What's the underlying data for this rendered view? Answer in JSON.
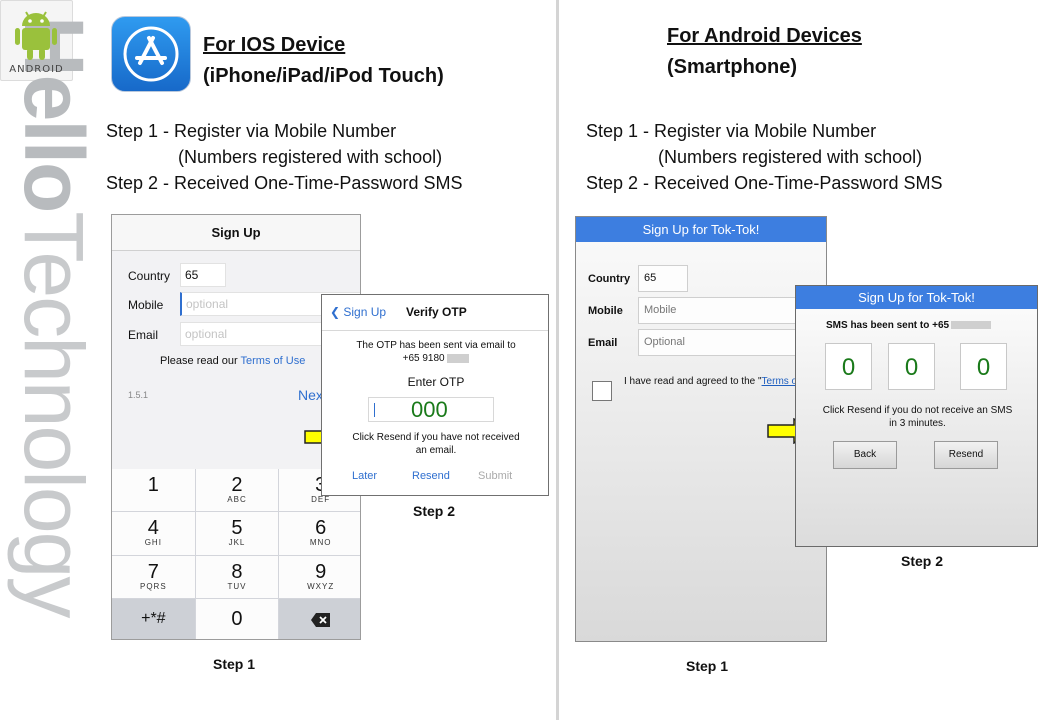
{
  "brand": {
    "bold": "Hello",
    "rest": "Technology"
  },
  "ios": {
    "header_line1": "For IOS Device",
    "header_line2": "(iPhone/iPad/iPod Touch)",
    "icon": "app-store-icon",
    "steps": {
      "step1": "Step 1 - Register via Mobile Number",
      "step1_note": "(Numbers registered with school)",
      "step2": "Step 2 - Received One-Time-Password SMS"
    },
    "signup": {
      "title": "Sign Up",
      "country_label": "Country",
      "country_value": "65",
      "mobile_label": "Mobile",
      "mobile_placeholder": "optional",
      "email_label": "Email",
      "email_placeholder": "optional",
      "terms_prefix": "Please read our",
      "terms_link": "Terms of Use",
      "version": "1.5.1",
      "next": "Next"
    },
    "keypad": [
      {
        "n": "1",
        "l": ""
      },
      {
        "n": "2",
        "l": "ABC"
      },
      {
        "n": "3",
        "l": "DEF"
      },
      {
        "n": "4",
        "l": "GHI"
      },
      {
        "n": "5",
        "l": "JKL"
      },
      {
        "n": "6",
        "l": "MNO"
      },
      {
        "n": "7",
        "l": "PQRS"
      },
      {
        "n": "8",
        "l": "TUV"
      },
      {
        "n": "9",
        "l": "WXYZ"
      },
      {
        "n": "+*#",
        "l": ""
      },
      {
        "n": "0",
        "l": ""
      },
      {
        "n": "",
        "l": ""
      }
    ],
    "otp": {
      "back": "Sign Up",
      "title": "Verify OTP",
      "msg_line1": "The OTP has been sent via email to",
      "msg_line2": "+65 9180",
      "enter_label": "Enter OTP",
      "code": "000",
      "note_line1": "Click Resend if you have not received",
      "note_line2": "an email.",
      "later": "Later",
      "resend": "Resend",
      "submit": "Submit"
    },
    "caption_step1": "Step 1",
    "caption_step2": "Step 2"
  },
  "android": {
    "header_line1": "For Android Devices",
    "header_line2": "(Smartphone)",
    "icon": "android-robot-icon",
    "icon_word": "ANDROID",
    "steps": {
      "step1": "Step 1 - Register via Mobile Number",
      "step1_note": "(Numbers registered with school)",
      "step2": "Step 2 - Received One-Time-Password SMS"
    },
    "signup": {
      "title": "Sign Up for Tok-Tok!",
      "country_label": "Country",
      "country_value": "65",
      "mobile_label": "Mobile",
      "mobile_placeholder": "Mobile",
      "email_label": "Email",
      "email_placeholder": "Optional",
      "agree_prefix": "I have read and agreed to the \"",
      "agree_link": "Terms of Use",
      "agree_suffix": "\""
    },
    "dialog": {
      "title": "Sign Up for Tok-Tok!",
      "sms_text": "SMS has been sent to +65",
      "digits": [
        "0",
        "0",
        "0"
      ],
      "note_line1": "Click Resend if you do not receive an SMS",
      "note_line2": "in 3 minutes.",
      "back": "Back",
      "resend": "Resend"
    },
    "caption_step1": "Step 1",
    "caption_step2": "Step 2"
  },
  "colors": {
    "arrow_fill": "#ffff00",
    "android_bar": "#3d7ee0",
    "ios_link": "#2f6fcf",
    "otp_code": "#1a7a1a"
  }
}
